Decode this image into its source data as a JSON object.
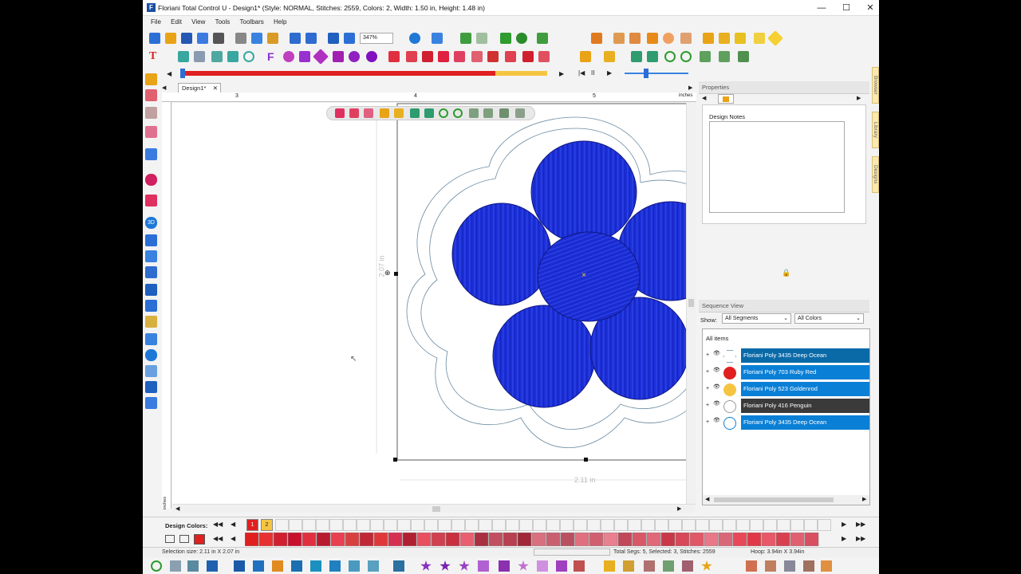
{
  "window": {
    "title": "Floriani Total Control U - Design1* (Style: NORMAL, Stitches: 2559, Colors: 2, Width: 1.50 in, Height: 1.48 in)",
    "minimize": "—",
    "maximize": "☐",
    "close": "✕"
  },
  "menu": [
    "File",
    "Edit",
    "View",
    "Tools",
    "Toolbars",
    "Help"
  ],
  "zoom": "347%",
  "document_tab": {
    "label": "Design1*",
    "close": "✕"
  },
  "ruler": {
    "h_ticks": [
      "3",
      "4",
      "5"
    ],
    "units": "inches",
    "v_units": "inches"
  },
  "design": {
    "height_label": "2.07 in",
    "width_label": "2.11 in"
  },
  "properties": {
    "title": "Properties",
    "design_notes_label": "Design Notes",
    "design_notes_value": ""
  },
  "side_tabs": [
    "Browser",
    "Library",
    "Designs"
  ],
  "sequence": {
    "title": "Sequence View",
    "show_label": "Show:",
    "segments_filter": "All Segments",
    "colors_filter": "All Colors",
    "root": "All items",
    "items": [
      {
        "label": "Floriani Poly 3435 Deep Ocean",
        "bg": "#0a6aa8",
        "icon": "hexagon-outline-icon"
      },
      {
        "label": "Floriani Poly 703 Ruby Red",
        "bg": "#0a7fd6",
        "icon": "red-flower-icon"
      },
      {
        "label": "Floriani Poly 523 Goldenrod",
        "bg": "#0a7fd6",
        "icon": "yellow-circle-icon"
      },
      {
        "label": "Floriani Poly 416 Penguin",
        "bg": "#3a3a3a",
        "icon": "white-flower-icon"
      },
      {
        "label": "Floriani Poly 3435 Deep Ocean",
        "bg": "#0a7fd6",
        "icon": "blue-flower-outline-icon"
      }
    ]
  },
  "design_colors": {
    "label": "Design Colors:",
    "used": [
      "1",
      "2"
    ]
  },
  "status": {
    "selection": "Selection size: 2.11 in X 2.07 in",
    "totals": "Total Segs: 5, Selected: 3, Stitches: 2559",
    "hoop": "Hoop: 3.94in X 3.94in"
  },
  "colors": {
    "progress_red": "#e02020",
    "progress_yellow": "#f5c542",
    "fill_blue": "#1c2fd6",
    "selection_blue": "#0a7fd6"
  }
}
